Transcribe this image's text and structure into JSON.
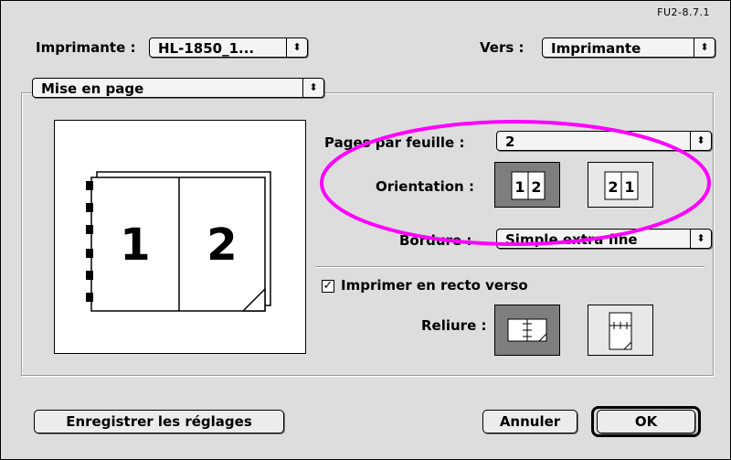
{
  "dialog": {
    "version": "FU2-8.7.1",
    "printer_label": "Imprimante :",
    "printer_value": "HL-1850_1...",
    "dest_label": "Vers :",
    "dest_value": "Imprimante",
    "panel_value": "Mise en page"
  },
  "preview": {
    "page1": "1",
    "page2": "2"
  },
  "layout": {
    "pages_label": "Pages par feuille :",
    "pages_value": "2",
    "orientation_label": "Orientation :",
    "orientation_options": [
      "1 2",
      "2 1"
    ],
    "orientation_selected": 0,
    "border_label": "Bordure :",
    "border_value": "Simple extra fine"
  },
  "duplex": {
    "checkbox_label": "Imprimer en recto verso",
    "checked": true,
    "binding_label": "Reliure :",
    "binding_selected": 0
  },
  "buttons": {
    "save": "Enregistrer les réglages",
    "cancel": "Annuler",
    "ok": "OK"
  },
  "annotation_color": "#ff00ff"
}
